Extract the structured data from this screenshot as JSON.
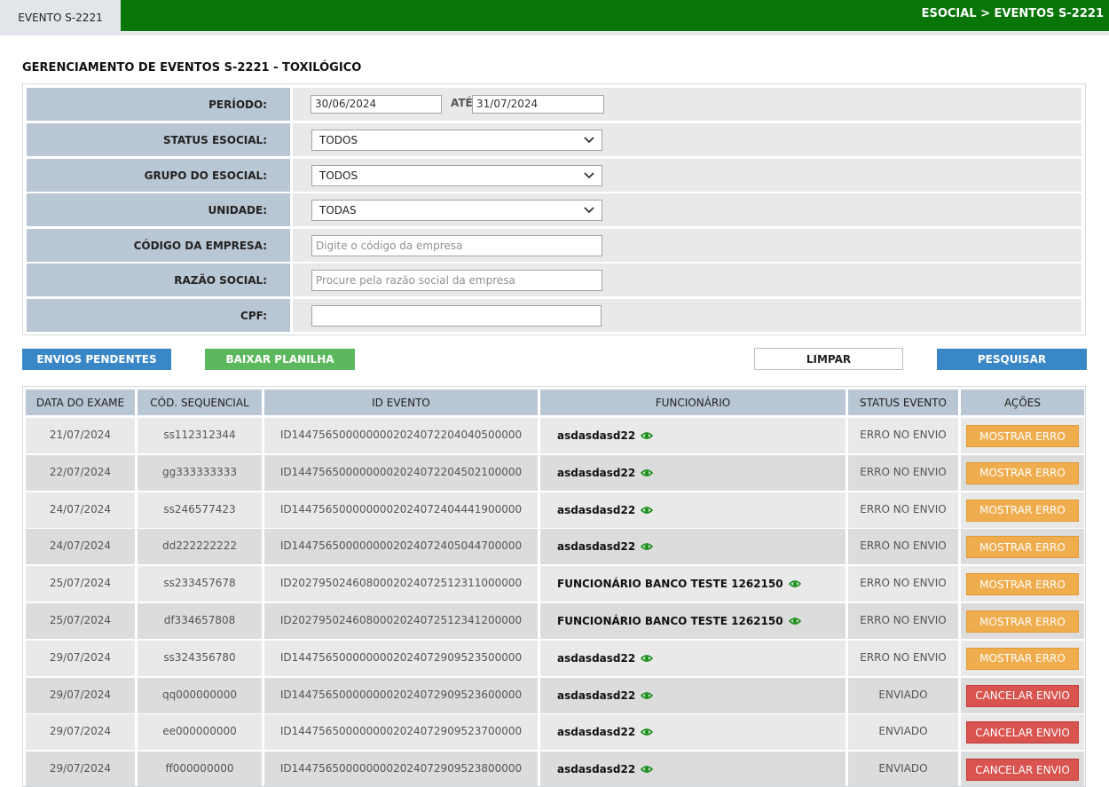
{
  "header": {
    "tab_label": "EVENTO S-2221",
    "breadcrumb": "ESOCIAL > EVENTOS S-2221"
  },
  "page": {
    "title": "GERENCIAMENTO DE EVENTOS S-2221 - TOXILÓGICO"
  },
  "filters": {
    "periodo_label": "PERÍODO:",
    "periodo_from": "30/06/2024",
    "ate_label": "ATÉ",
    "periodo_to": "31/07/2024",
    "status_label": "STATUS ESOCIAL:",
    "status_value": "TODOS",
    "grupo_label": "GRUPO DO ESOCIAL:",
    "grupo_value": "TODOS",
    "unidade_label": "UNIDADE:",
    "unidade_value": "TODAS",
    "codigo_label": "CÓDIGO DA EMPRESA:",
    "codigo_placeholder": "Digite o código da empresa",
    "razao_label": "RAZÃO SOCIAL:",
    "razao_placeholder": "Procure pela razão social da empresa",
    "cpf_label": "CPF:",
    "cpf_value": ""
  },
  "buttons": {
    "envios": "ENVIOS PENDENTES",
    "baixar": "BAIXAR PLANILHA",
    "limpar": "LIMPAR",
    "pesquisar": "PESQUISAR"
  },
  "table": {
    "headers": [
      "DATA DO EXAME",
      "CÓD. SEQUENCIAL",
      "ID EVENTO",
      "FUNCIONÁRIO",
      "STATUS EVENTO",
      "AÇÕES"
    ],
    "rows": [
      {
        "data": "21/07/2024",
        "cod": "ss112312344",
        "id": "ID1447565000000002024072204040500000",
        "func": "asdasdasd22",
        "status": "ERRO NO ENVIO",
        "action": "MOSTRAR ERRO"
      },
      {
        "data": "22/07/2024",
        "cod": "gg333333333",
        "id": "ID1447565000000002024072204502100000",
        "func": "asdasdasd22",
        "status": "ERRO NO ENVIO",
        "action": "MOSTRAR ERRO"
      },
      {
        "data": "24/07/2024",
        "cod": "ss246577423",
        "id": "ID1447565000000002024072404441900000",
        "func": "asdasdasd22",
        "status": "ERRO NO ENVIO",
        "action": "MOSTRAR ERRO"
      },
      {
        "data": "24/07/2024",
        "cod": "dd222222222",
        "id": "ID1447565000000002024072405044700000",
        "func": "asdasdasd22",
        "status": "ERRO NO ENVIO",
        "action": "MOSTRAR ERRO"
      },
      {
        "data": "25/07/2024",
        "cod": "ss233457678",
        "id": "ID2027950246080002024072512311000000",
        "func": "FUNCIONÁRIO BANCO TESTE 1262150",
        "status": "ERRO NO ENVIO",
        "action": "MOSTRAR ERRO"
      },
      {
        "data": "25/07/2024",
        "cod": "df334657808",
        "id": "ID2027950246080002024072512341200000",
        "func": "FUNCIONÁRIO BANCO TESTE 1262150",
        "status": "ERRO NO ENVIO",
        "action": "MOSTRAR ERRO"
      },
      {
        "data": "29/07/2024",
        "cod": "ss324356780",
        "id": "ID1447565000000002024072909523500000",
        "func": "asdasdasd22",
        "status": "ERRO NO ENVIO",
        "action": "MOSTRAR ERRO"
      },
      {
        "data": "29/07/2024",
        "cod": "qq000000000",
        "id": "ID1447565000000002024072909523600000",
        "func": "asdasdasd22",
        "status": "ENVIADO",
        "action": "CANCELAR ENVIO"
      },
      {
        "data": "29/07/2024",
        "cod": "ee000000000",
        "id": "ID1447565000000002024072909523700000",
        "func": "asdasdasd22",
        "status": "ENVIADO",
        "action": "CANCELAR ENVIO"
      },
      {
        "data": "29/07/2024",
        "cod": "ff000000000",
        "id": "ID1447565000000002024072909523800000",
        "func": "asdasdasd22",
        "status": "ENVIADO",
        "action": "CANCELAR ENVIO"
      }
    ]
  },
  "colors": {
    "header_green": "#077507",
    "label_bg": "#b9c6d3",
    "warning": "#f0ad4e",
    "danger": "#d9534f",
    "primary": "#3a87c8",
    "success": "#5cb85c",
    "eye_icon": "#1a8f1a"
  },
  "icons": {
    "view": "eye-icon",
    "dropdown": "chevron-down-icon"
  }
}
